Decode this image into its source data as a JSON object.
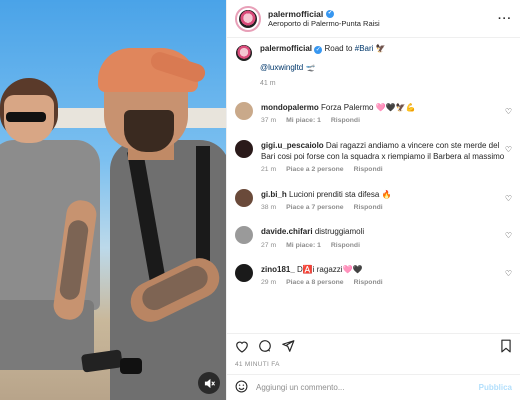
{
  "post": {
    "username": "palermofficial",
    "location": "Aeroporto di Palermo-Punta Raisi",
    "caption_text": "Road to",
    "caption_tag": "#Bari",
    "caption_emoji": "🦅",
    "caption_mention": "@luxwingltd",
    "caption_mention_emoji": "🛫",
    "caption_time": "41 m"
  },
  "comments": [
    {
      "user": "mondopalermo",
      "text": "Forza Palermo 🩷🖤🦅💪",
      "time": "37 m",
      "likes": "Mi piace: 1",
      "reply": "Rispondi",
      "avatar_color": "#c9a98a"
    },
    {
      "user": "gigi.u_pescaiolo",
      "text": "Dai ragazzi andiamo a vincere con ste merde del Bari cosi poi forse con la squadra x riempiamo il Barbera al massimo",
      "time": "21 m",
      "likes": "Piace a 2 persone",
      "reply": "Rispondi",
      "avatar_color": "#2a1a1a"
    },
    {
      "user": "gi.bi_h",
      "text": "Lucioni prenditi sta difesa 🔥",
      "time": "38 m",
      "likes": "Piace a 7 persone",
      "reply": "Rispondi",
      "avatar_color": "#6a4a3a"
    },
    {
      "user": "davide.chifari",
      "text": "distruggiamoli",
      "time": "27 m",
      "likes": "Mi piace: 1",
      "reply": "Rispondi",
      "avatar_color": "#9a9a9a"
    },
    {
      "user": "zino181_",
      "text": "D🅰️i ragazzi🩷🖤",
      "time": "29 m",
      "likes": "Piace a 8 persone",
      "reply": "Rispondi",
      "avatar_color": "#1a1a1a"
    }
  ],
  "actions": {
    "like": "♡",
    "comment": "◯",
    "share": "➤",
    "save": "⬚"
  },
  "posted_ago": "41 MINUTI FA",
  "add_comment": {
    "placeholder": "Aggiungi un commento...",
    "publish": "Pubblica"
  },
  "icons": {
    "more": "more-dots-icon",
    "verified": "verified-badge-icon",
    "mute": "muted-audio-icon",
    "emoji": "emoji-smile-icon"
  },
  "colors": {
    "verified": "#3897f0",
    "link": "#00376b",
    "muted_text": "#8e8e8e",
    "publish_disabled": "#b2dffc"
  }
}
